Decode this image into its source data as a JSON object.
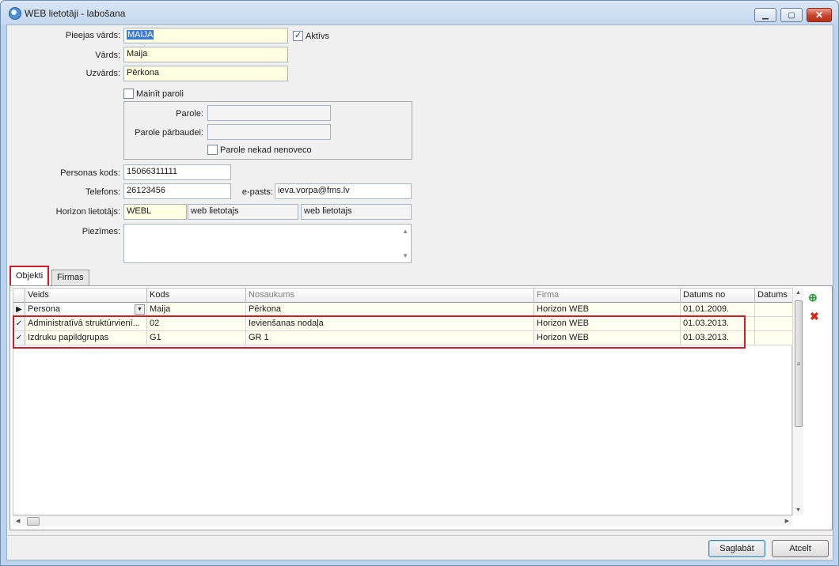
{
  "window": {
    "title": "WEB lietotāji - labošana"
  },
  "form": {
    "login_label": "Pieejas vārds:",
    "login_value": "MAIJA",
    "active_label": "Aktīvs",
    "active_checked": true,
    "first_name_label": "Vārds:",
    "first_name_value": "Maija",
    "last_name_label": "Uzvārds:",
    "last_name_value": "Pērkona",
    "change_password_label": "Mainīt paroli",
    "change_password_checked": false,
    "password_label": "Parole:",
    "password_value": "",
    "password_confirm_label": "Parole pārbaudei:",
    "password_confirm_value": "",
    "never_expires_label": "Parole nekad nenoveco",
    "never_expires_checked": false,
    "personal_code_label": "Personas kods:",
    "personal_code_value": "15066311111",
    "phone_label": "Telefons:",
    "phone_value": "26123456",
    "email_label": "e-pasts:",
    "email_value": "ieva.vorpa@fms.lv",
    "horizon_user_label": "Horizon lietotājs:",
    "horizon_user_code": "WEBL",
    "horizon_user_name": "web lietotajs",
    "horizon_user_name2": "web lietotajs",
    "notes_label": "Piezīmes:",
    "notes_value": ""
  },
  "tabs": [
    {
      "label": "Objekti",
      "active": true
    },
    {
      "label": "Firmas",
      "active": false
    }
  ],
  "grid": {
    "columns": [
      "Veids",
      "Kods",
      "Nosaukums",
      "Firma",
      "Datums no",
      "Datums"
    ],
    "rows": [
      {
        "marker": "▶",
        "veids": "Persona",
        "kods": "Maija",
        "nosaukums": "Pērkona",
        "firma": "Horizon WEB",
        "datums_no": "01.01.2009.",
        "datums": ""
      },
      {
        "marker": "✓",
        "veids": "Administratīvā struktūrvienī...",
        "kods": "02",
        "nosaukums": "Ievienšanas nodaļa",
        "firma": "Horizon WEB",
        "datums_no": "01.03.2013.",
        "datums": ""
      },
      {
        "marker": "✓",
        "veids": "Izdruku papildgrupas",
        "kods": "G1",
        "nosaukums": "GR 1",
        "firma": "Horizon WEB",
        "datums_no": "01.03.2013.",
        "datums": ""
      }
    ]
  },
  "buttons": {
    "save": "Saglabāt",
    "cancel": "Atcelt"
  },
  "colors": {
    "accent": "#c8202a",
    "required_field": "#ffffe1",
    "title_bar": "#c3d7ee"
  }
}
